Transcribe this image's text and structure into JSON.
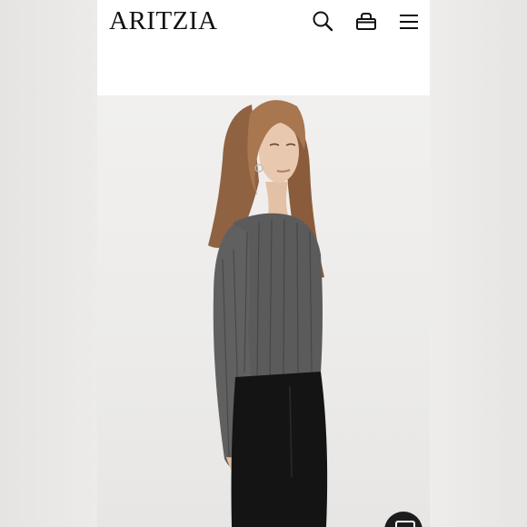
{
  "header": {
    "logo": "ARITZIA",
    "cut_text": "· · ·"
  },
  "icons": {
    "search": "search-icon",
    "bag": "shopping-bag-icon",
    "menu": "hamburger-menu-icon",
    "chat": "chat-icon"
  },
  "colors": {
    "sweater": "#5b5b5b",
    "pants": "#141414",
    "hair": "#9a6a44",
    "background": "#eeeceb"
  }
}
